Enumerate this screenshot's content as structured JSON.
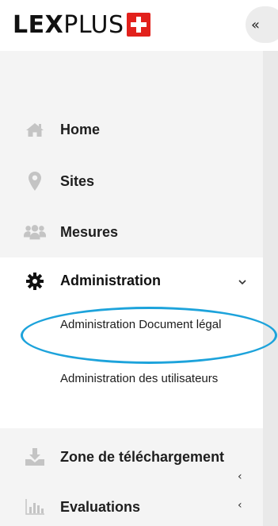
{
  "header": {
    "logo_text_bold": "LEX",
    "logo_text_regular": "PLUS",
    "logo_flag_icon": "swiss-flag-icon",
    "collapse_glyph": "«"
  },
  "sidebar": {
    "items": [
      {
        "label": "Home",
        "icon": "home-icon"
      },
      {
        "label": "Sites",
        "icon": "map-marker-icon"
      },
      {
        "label": "Mesures",
        "icon": "users-icon"
      }
    ],
    "admin": {
      "label": "Administration",
      "icon": "gear-icon",
      "expanded": true,
      "sub_items": [
        {
          "label": "Administration Document légal",
          "highlighted": true
        },
        {
          "label": "Administration des utilisateurs"
        }
      ]
    },
    "bottom_items": [
      {
        "label": "Zone de téléchargement",
        "icon": "download-icon"
      },
      {
        "label": "Evaluations",
        "icon": "bar-chart-icon"
      }
    ],
    "chevron_glyph": "‹"
  },
  "colors": {
    "highlight_ellipse": "#1da3db",
    "logo_flag": "#e2211c",
    "icon_gray": "#c4c4c4",
    "sidebar_bg": "#f4f4f4"
  }
}
